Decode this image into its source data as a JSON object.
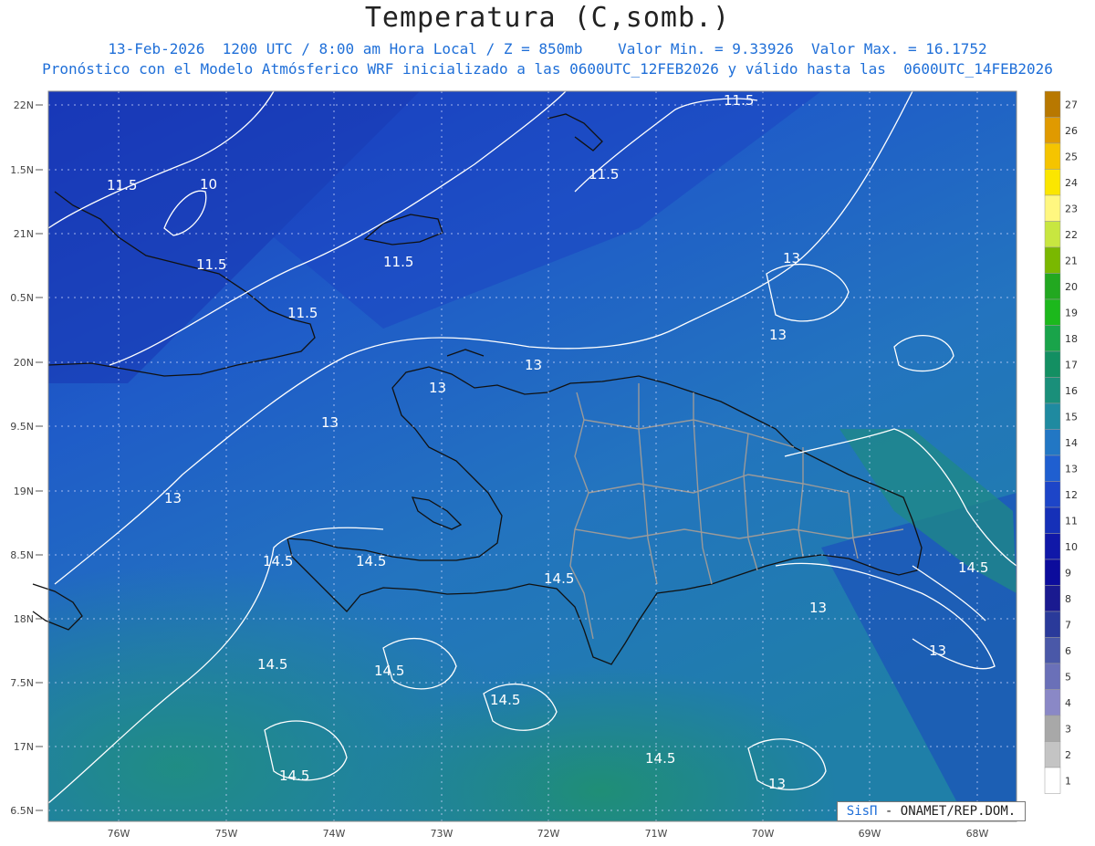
{
  "header": {
    "title": "Temperatura (C,somb.)",
    "line1": "13-Feb-2026  1200 UTC / 8:00 am Hora Local / Z = 850mb    Valor Min. = 9.33926  Valor Max. = 16.1752",
    "line2": "Pronóstico con el Modelo Atmósferico WRF inicializado a las 0600UTC_12FEB2026 y válido hasta las  0600UTC_14FEB2026"
  },
  "map": {
    "lon_labels": [
      "76W",
      "75W",
      "74W",
      "73W",
      "72W",
      "71W",
      "70W",
      "69W",
      "68W"
    ],
    "lat_labels": [
      "22N",
      "1.5N",
      "21N",
      "0.5N",
      "20N",
      "9.5N",
      "19N",
      "8.5N",
      "18N",
      "7.5N",
      "17N",
      "6.5N"
    ],
    "contour_labels": [
      "11.5",
      "10",
      "11.5",
      "11.5",
      "11.5",
      "11.5",
      "11.5",
      "13",
      "13",
      "13",
      "13",
      "13",
      "13",
      "14.5",
      "14.5",
      "14.5",
      "14.5",
      "14.5",
      "14.5",
      "14.5",
      "14.5",
      "13",
      "13",
      "13",
      "14.5"
    ]
  },
  "colorbar": {
    "labels": [
      "27",
      "26",
      "25",
      "24",
      "23",
      "22",
      "21",
      "20",
      "19",
      "18",
      "17",
      "16",
      "15",
      "14",
      "13",
      "12",
      "11",
      "10",
      "9",
      "8",
      "7",
      "6",
      "5",
      "4",
      "3",
      "2",
      "1"
    ],
    "colors": [
      "#b87800",
      "#e09a00",
      "#f5c400",
      "#fbe600",
      "#fff780",
      "#c8e640",
      "#7ab800",
      "#22a820",
      "#1cb81c",
      "#19a44a",
      "#138f62",
      "#1a8f7a",
      "#1f8aa0",
      "#2277c4",
      "#1f5fd0",
      "#1d45c8",
      "#1530b8",
      "#1018a8",
      "#0c0c9c",
      "#1a1a90",
      "#2a3a9a",
      "#4a58a8",
      "#6a70b8",
      "#8a88c6",
      "#a8a8a8",
      "#c4c4c4",
      "#ffffff"
    ]
  },
  "credit": {
    "sis": "SisΠ",
    "text": "- ONAMET/REP.DOM."
  }
}
